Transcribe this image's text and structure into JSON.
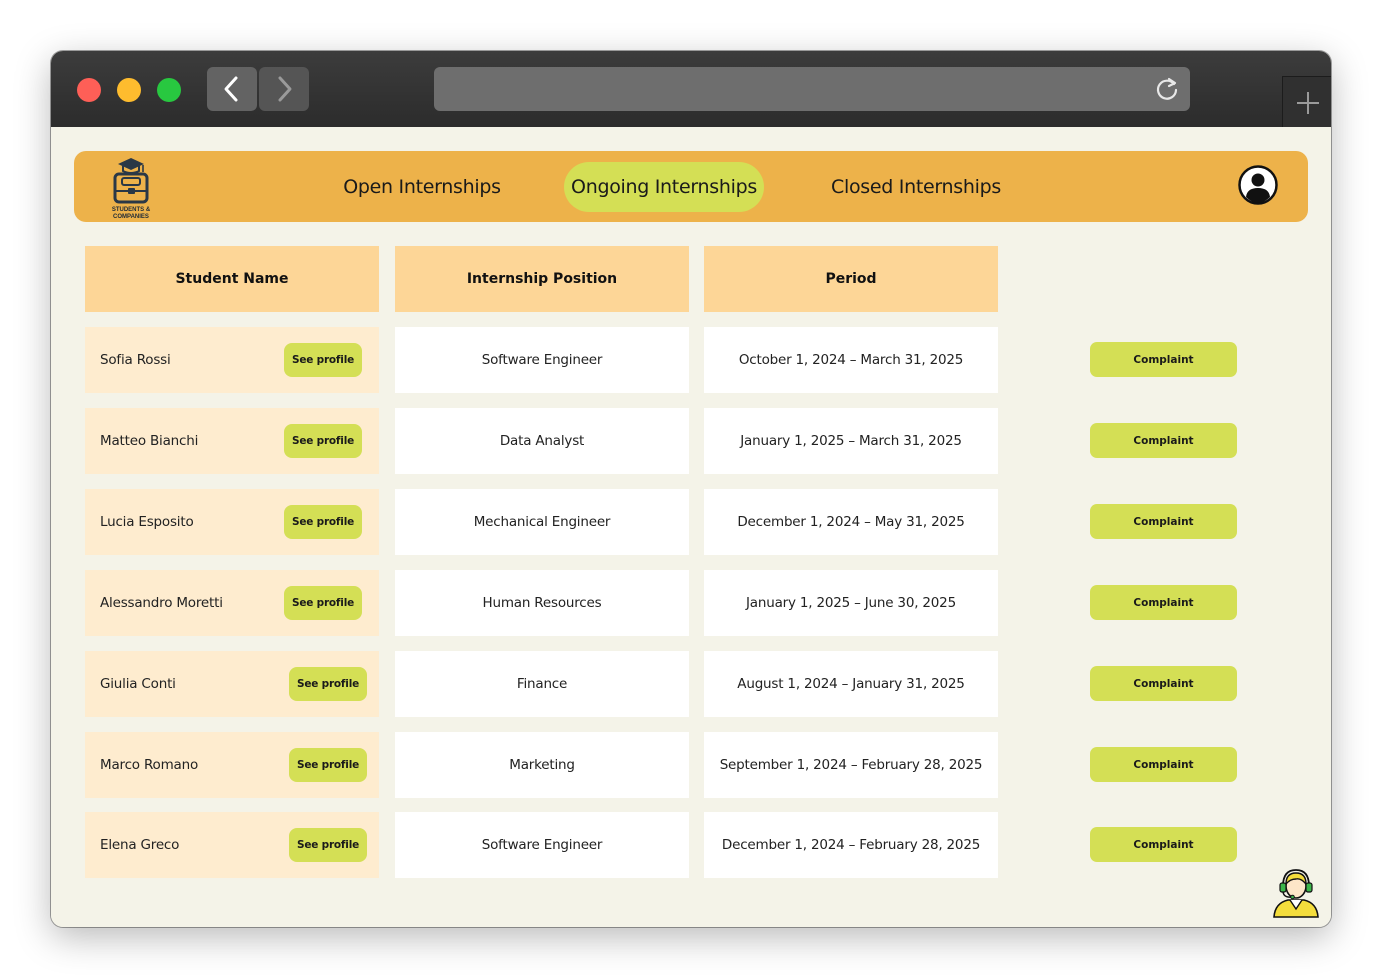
{
  "browser": {
    "icons": {
      "back": "chevron-left-icon",
      "forward": "chevron-right-icon",
      "reload": "reload-icon",
      "new_tab": "plus-icon"
    }
  },
  "logo": {
    "line1": "STUDENTS &",
    "line2": "COMPANIES"
  },
  "nav": {
    "tabs": [
      {
        "label": "Open Internships"
      },
      {
        "label": "Ongoing Internships",
        "active": true
      },
      {
        "label": "Closed Internships"
      }
    ]
  },
  "table": {
    "headers": [
      "Student Name",
      "Internship Position",
      "Period"
    ],
    "see_profile_label": "See profile",
    "complaint_label": "Complaint",
    "rows": [
      {
        "name": "Sofia Rossi",
        "position": "Software Engineer",
        "period": "October 1, 2024 – March 31, 2025"
      },
      {
        "name": "Matteo Bianchi",
        "position": "Data Analyst",
        "period": "January 1, 2025 – March 31, 2025"
      },
      {
        "name": "Lucia Esposito",
        "position": "Mechanical Engineer",
        "period": "December 1, 2024 – May 31, 2025"
      },
      {
        "name": "Alessandro Moretti",
        "position": "Human Resources",
        "period": "January 1, 2025 – June 30, 2025"
      },
      {
        "name": "Giulia Conti",
        "position": "Finance",
        "period": "August 1, 2024 – January 31, 2025"
      },
      {
        "name": "Marco Romano",
        "position": "Marketing",
        "period": "September 1, 2024 – February 28, 2025"
      },
      {
        "name": "Elena Greco",
        "position": "Software Engineer",
        "period": "December 1, 2024 – February 28, 2025"
      }
    ]
  },
  "colors": {
    "nav_bg": "#edb24a",
    "accent": "#d4df55",
    "header_bg": "#fdd697",
    "name_cell_bg": "#feeccf",
    "page_bg": "#f4f3e8"
  }
}
